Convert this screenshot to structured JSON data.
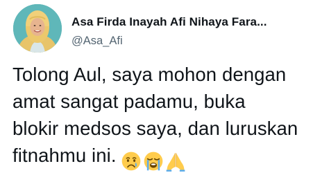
{
  "tweet": {
    "author": {
      "display_name": "Asa Firda Inayah Afi Nihaya Fara...",
      "handle": "@Asa_Afi"
    },
    "text_lines": [
      "Tolong Aul, saya mohon dengan",
      "amat sangat padamu, buka",
      "blokir medsos saya, dan luruskan",
      "fitnahmu ini."
    ],
    "emojis": [
      "crying-face-icon",
      "loudly-crying-face-icon",
      "folded-hands-icon"
    ]
  },
  "colors": {
    "text_primary": "#0f1419",
    "text_secondary": "#536471",
    "background": "#ffffff",
    "avatar_background": "#5fb7b9",
    "hijab": "#f1d07a"
  }
}
